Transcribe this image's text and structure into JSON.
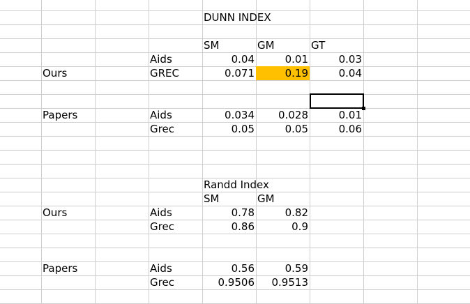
{
  "dunn": {
    "title": "DUNN INDEX",
    "headers": [
      "SM",
      "GM",
      "GT"
    ],
    "ours_label": "Ours",
    "papers_label": "Papers",
    "ours_rows": [
      {
        "name": "Aids",
        "values": [
          "0.04",
          "0.01",
          "0.03"
        ]
      },
      {
        "name": "GREC",
        "values": [
          "0.071",
          "0.19",
          "0.04"
        ]
      }
    ],
    "papers_rows": [
      {
        "name": "Aids",
        "values": [
          "0.034",
          "0.028",
          "0.01"
        ]
      },
      {
        "name": "Grec",
        "values": [
          "0.05",
          "0.05",
          "0.06"
        ]
      }
    ],
    "highlight_color": "#ffc000"
  },
  "rand": {
    "title": "Randd Index",
    "headers": [
      "SM",
      "GM"
    ],
    "ours_label": "Ours",
    "papers_label": "Papers",
    "ours_rows": [
      {
        "name": "Aids",
        "values": [
          "0.78",
          "0.82"
        ]
      },
      {
        "name": "Grec",
        "values": [
          "0.86",
          "0.9"
        ]
      }
    ],
    "papers_rows": [
      {
        "name": "Aids",
        "values": [
          "0.56",
          "0.59"
        ]
      },
      {
        "name": "Grec",
        "values": [
          "0.9506",
          "0.9513"
        ]
      }
    ]
  }
}
